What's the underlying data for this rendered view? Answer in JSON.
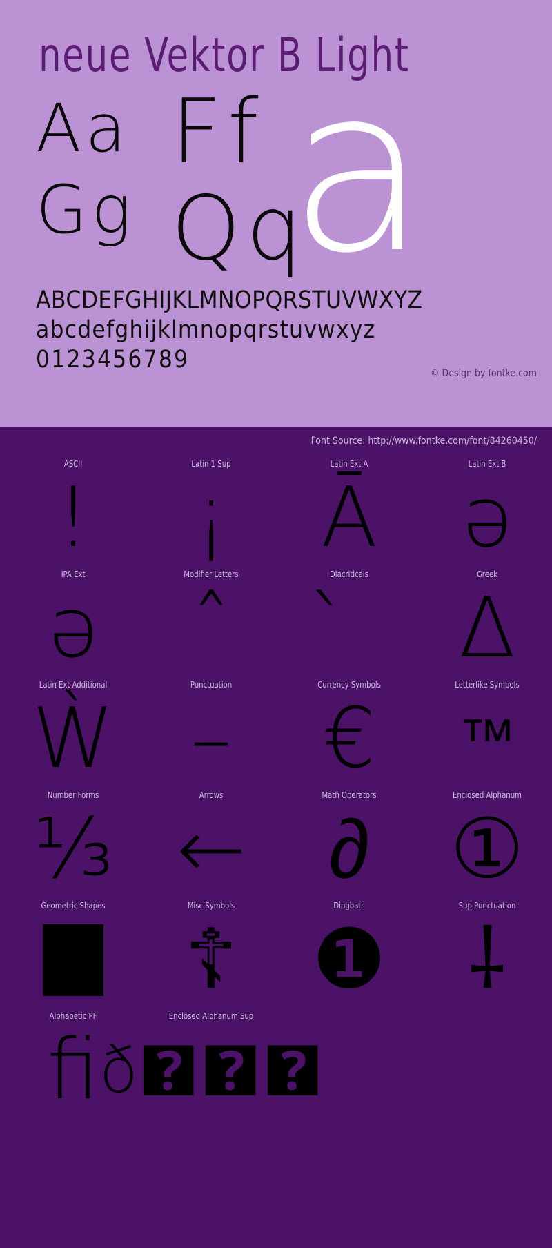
{
  "title": "neue Vektor B Light",
  "sample": {
    "small_row1": "Aa",
    "small_row2": "Gg",
    "mid_row1": "Ff",
    "mid_row2": "Qq",
    "big": "a"
  },
  "alphabet": {
    "uppercase": "ABCDEFGHIJKLMNOPQRSTUVWXYZ",
    "lowercase": "abcdefghijklmnopqrstuvwxyz",
    "digits": "0123456789"
  },
  "copyright": "© Design by fontke.com",
  "font_source": "Font Source: http://www.fontke.com/font/84260450/",
  "colors": {
    "light_panel": "#bb92d3",
    "dark_panel": "#4b1268",
    "title_text": "#5b1d73",
    "glyph_black": "#000000",
    "glyph_white": "#ffffff",
    "label_text": "#cdbadd"
  },
  "coverage_grid": {
    "rows": [
      [
        {
          "label": "ASCII",
          "glyph": "!",
          "size": "lg"
        },
        {
          "label": "Latin 1 Sup",
          "glyph": "¡",
          "size": "lg"
        },
        {
          "label": "Latin Ext A",
          "glyph": "Ā",
          "size": "lg"
        },
        {
          "label": "Latin Ext B",
          "glyph": "ǝ",
          "size": "lg"
        }
      ],
      [
        {
          "label": "IPA Ext",
          "glyph": "ə",
          "size": "lg"
        },
        {
          "label": "Modifier Letters",
          "glyph": "ˆ",
          "size": "lg"
        },
        {
          "label": "Diacriticals",
          "glyph": "̀",
          "size": "lg"
        },
        {
          "label": "Greek",
          "glyph": "Δ",
          "size": "lg"
        }
      ],
      [
        {
          "label": "Latin Ext Additional",
          "glyph": "Ẁ",
          "size": "lg"
        },
        {
          "label": "Punctuation",
          "glyph": "–",
          "size": "lg"
        },
        {
          "label": "Currency Symbols",
          "glyph": "€",
          "size": "lg"
        },
        {
          "label": "Letterlike Symbols",
          "glyph": "™",
          "size": "sm"
        }
      ],
      [
        {
          "label": "Number Forms",
          "glyph": "⅓",
          "size": "lg"
        },
        {
          "label": "Arrows",
          "glyph": "←",
          "size": "lg"
        },
        {
          "label": "Math Operators",
          "glyph": "∂",
          "size": "lg"
        },
        {
          "label": "Enclosed Alphanum",
          "glyph": "①",
          "size": "lg"
        }
      ],
      [
        {
          "label": "Geometric Shapes",
          "glyph": "■",
          "size": "square"
        },
        {
          "label": "Misc Symbols",
          "glyph": "☦",
          "size": "lg"
        },
        {
          "label": "Dingbats",
          "glyph": "❶",
          "size": "lg"
        },
        {
          "label": "Sup Punctuation",
          "glyph": "⸸",
          "size": "lg"
        }
      ],
      [
        {
          "label": "Alphabetic PF",
          "glyph": "ﬁ",
          "size": "lg"
        },
        {
          "label": "Enclosed Alphanum Sup",
          "glyph": "ð🯄🯄🯄",
          "size": "multi"
        },
        {
          "label": "",
          "glyph": "",
          "size": "sm"
        },
        {
          "label": "",
          "glyph": "",
          "size": "sm"
        }
      ]
    ]
  }
}
